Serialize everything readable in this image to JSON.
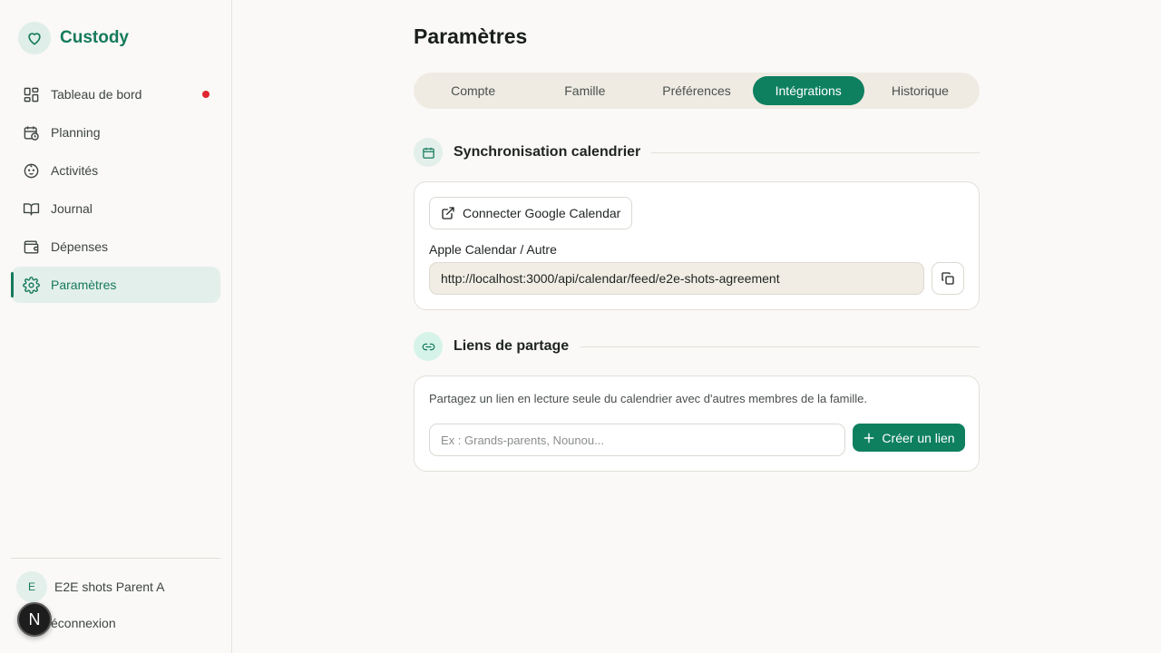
{
  "brand": {
    "name": "Custody",
    "logo_icon": "heart-icon"
  },
  "sidebar": {
    "items": [
      {
        "label": "Tableau de bord",
        "icon": "dashboard-icon",
        "notification": true
      },
      {
        "label": "Planning",
        "icon": "calendar-clock-icon"
      },
      {
        "label": "Activités",
        "icon": "baby-face-icon"
      },
      {
        "label": "Journal",
        "icon": "book-open-icon"
      },
      {
        "label": "Dépenses",
        "icon": "wallet-icon"
      },
      {
        "label": "Paramètres",
        "icon": "gear-icon",
        "active": true
      }
    ],
    "user": {
      "initial": "E",
      "name": "E2E shots Parent A"
    },
    "logout_label": "éconnexion",
    "dev_badge": "N"
  },
  "page": {
    "title": "Paramètres",
    "tabs": [
      "Compte",
      "Famille",
      "Préférences",
      "Intégrations",
      "Historique"
    ],
    "active_tab": "Intégrations"
  },
  "calendar_sync": {
    "title": "Synchronisation calendrier",
    "google_button": "Connecter Google Calendar",
    "apple_label": "Apple Calendar / Autre",
    "feed_url": "http://localhost:3000/api/calendar/feed/e2e-shots-agreement"
  },
  "share_links": {
    "title": "Liens de partage",
    "description": "Partagez un lien en lecture seule du calendrier avec d'autres membres de la famille.",
    "input_placeholder": "Ex : Grands-parents, Nounou...",
    "create_button": "Créer un lien"
  },
  "colors": {
    "accent": "#0e8060",
    "brand": "#157a5b",
    "notification": "#e0262f",
    "background": "#faf9f7"
  }
}
